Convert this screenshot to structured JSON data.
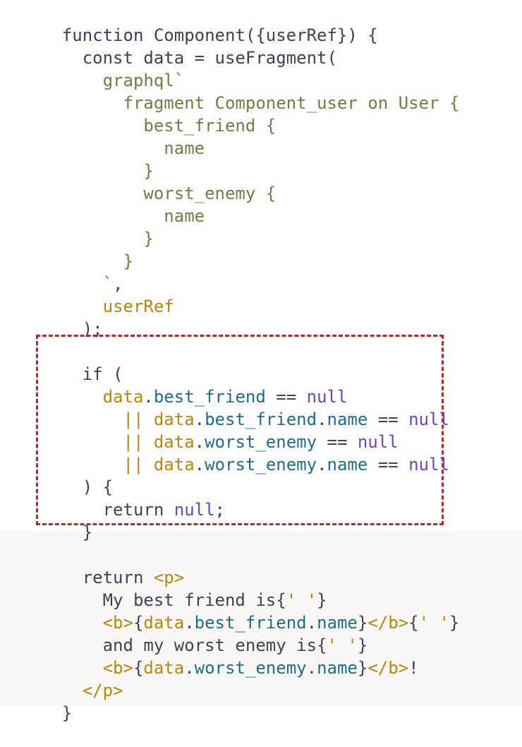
{
  "code": {
    "language": "javascript",
    "lines": [
      "function Component({userRef}) {",
      "  const data = useFragment(",
      "    graphql`",
      "      fragment Component_user on User {",
      "        best_friend {",
      "          name",
      "        }",
      "        worst_enemy {",
      "          name",
      "        }",
      "      }",
      "    `,",
      "    userRef",
      "  );",
      "",
      "  if (",
      "    data.best_friend == null",
      "      || data.best_friend.name == null",
      "      || data.worst_enemy == null",
      "      || data.worst_enemy.name == null",
      "  ) {",
      "    return null;",
      "  }",
      "",
      "  return <p>",
      "    My best friend is{' '}",
      "    <b>{data.best_friend.name}</b>{' '}",
      "    and my worst enemy is{' '}",
      "    <b>{data.worst_enemy.name}</b>!",
      "  </p>",
      "}"
    ]
  },
  "colors": {
    "highlight_border": "#b52b2b",
    "graphql": "#6c7f42",
    "variable": "#b8860b",
    "property": "#1f6b8c",
    "literal": "#6f42c1",
    "bottom_background": "#faf8f7"
  }
}
